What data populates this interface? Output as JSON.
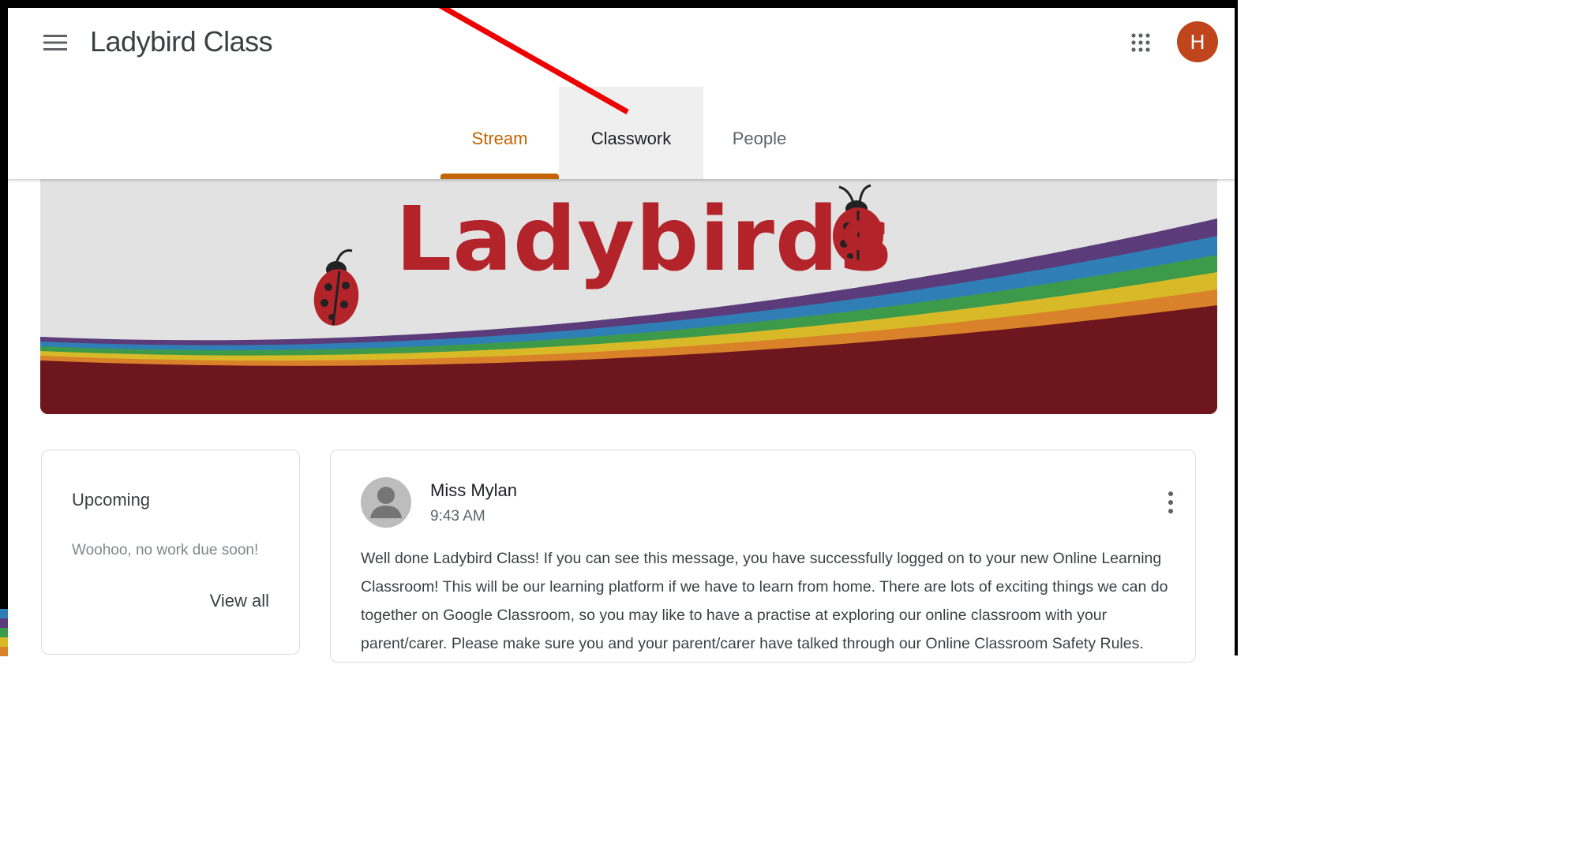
{
  "header": {
    "class_title": "Ladybird Class",
    "avatar_initial": "H",
    "avatar_color": "#c0441c",
    "menu_icon": "menu-icon",
    "apps_icon": "apps-grid-icon"
  },
  "tabs": [
    {
      "label": "Stream",
      "active": true
    },
    {
      "label": "Classwork",
      "active": false,
      "hovered": true
    },
    {
      "label": "People",
      "active": false
    }
  ],
  "banner": {
    "title": "Ladybirds",
    "decoration": "ladybug-icons-and-rainbow-stripes"
  },
  "upcoming": {
    "heading": "Upcoming",
    "empty_message": "Woohoo, no work due soon!",
    "view_all": "View all"
  },
  "post": {
    "author": "Miss Mylan",
    "time": "9:43 AM",
    "body": "Well done Ladybird Class! If you can see this message, you have successfully logged on to your new Online Learning Classroom! This will be our learning platform if we have to learn from home. There are lots of exciting things we can do together on Google Classroom, so you may like to have a practise at exploring our online classroom with your parent/carer. Please make sure you and your parent/carer have talked through our Online Classroom Safety Rules."
  },
  "colors": {
    "accent": "#c26401",
    "banner_red": "#b3232a",
    "banner_bottom": "#6e161d",
    "annotation_arrow": "#ee0000"
  }
}
